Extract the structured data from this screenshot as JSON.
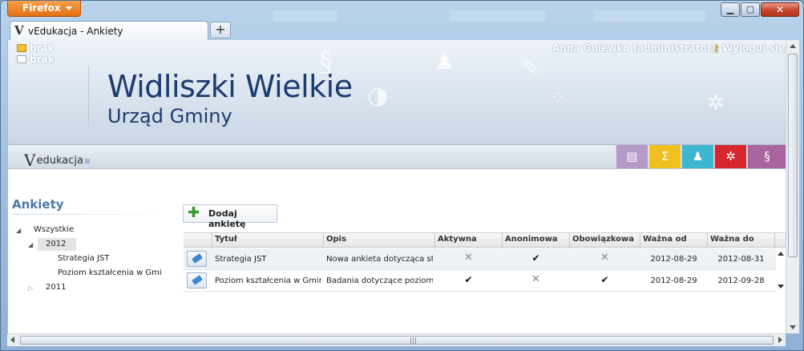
{
  "browser": {
    "menu_button": "Firefox",
    "tab_title": "vEdukacja - Ankiety",
    "tab_icon": "V",
    "new_tab": "+",
    "controls": {
      "minimize": "▁",
      "maximize": "▢",
      "close": "✕"
    }
  },
  "header": {
    "messages": [
      {
        "label": "brak",
        "icon": "envelope-icon"
      },
      {
        "label": "brak",
        "icon": "task-icon"
      }
    ],
    "user": "Anna Gniewko (administrator)",
    "logout": "Wyloguj się",
    "town": "Widliszki Wielkie",
    "office": "Urząd Gminy"
  },
  "brand": {
    "v": "V",
    "name": "edukacja"
  },
  "modules": [
    {
      "icon": "database-icon",
      "glyph": "▤",
      "color": "#b49ac9"
    },
    {
      "icon": "sigma-icon",
      "glyph": "Σ",
      "color": "#f0c021"
    },
    {
      "icon": "people-building-icon",
      "glyph": "♟",
      "color": "#3fb6d0"
    },
    {
      "icon": "network-icon",
      "glyph": "✲",
      "color": "#d6262e"
    },
    {
      "icon": "paragraph-icon",
      "glyph": "§",
      "color": "#a8649e"
    }
  ],
  "sidebar": {
    "title": "Ankiety",
    "tree": {
      "root": "Wszystkie",
      "year_open": "2012",
      "children": [
        "Strategia JST",
        "Poziom kształcenia w Gmi"
      ],
      "year_closed": "2011"
    }
  },
  "toolbar": {
    "add_label": "Dodaj ankietę"
  },
  "table": {
    "columns": [
      "Tytuł",
      "Opis",
      "Aktywna",
      "Anonimowa",
      "Obowiązkowa",
      "Ważna od",
      "Ważna do"
    ],
    "rows": [
      {
        "title": "Strategia JST",
        "desc": "Nowa ankieta dotycząca st",
        "active": "✕",
        "anon": "✔",
        "oblig": "✕",
        "from": "2012-08-29",
        "to": "2012-08-31"
      },
      {
        "title": "Poziom kształcenia w Gmir",
        "desc": "Badania dotyczące poziom",
        "active": "✔",
        "anon": "✕",
        "oblig": "✔",
        "from": "2012-08-29",
        "to": "2012-09-28"
      }
    ]
  },
  "scroll": {
    "grip": "|||"
  }
}
